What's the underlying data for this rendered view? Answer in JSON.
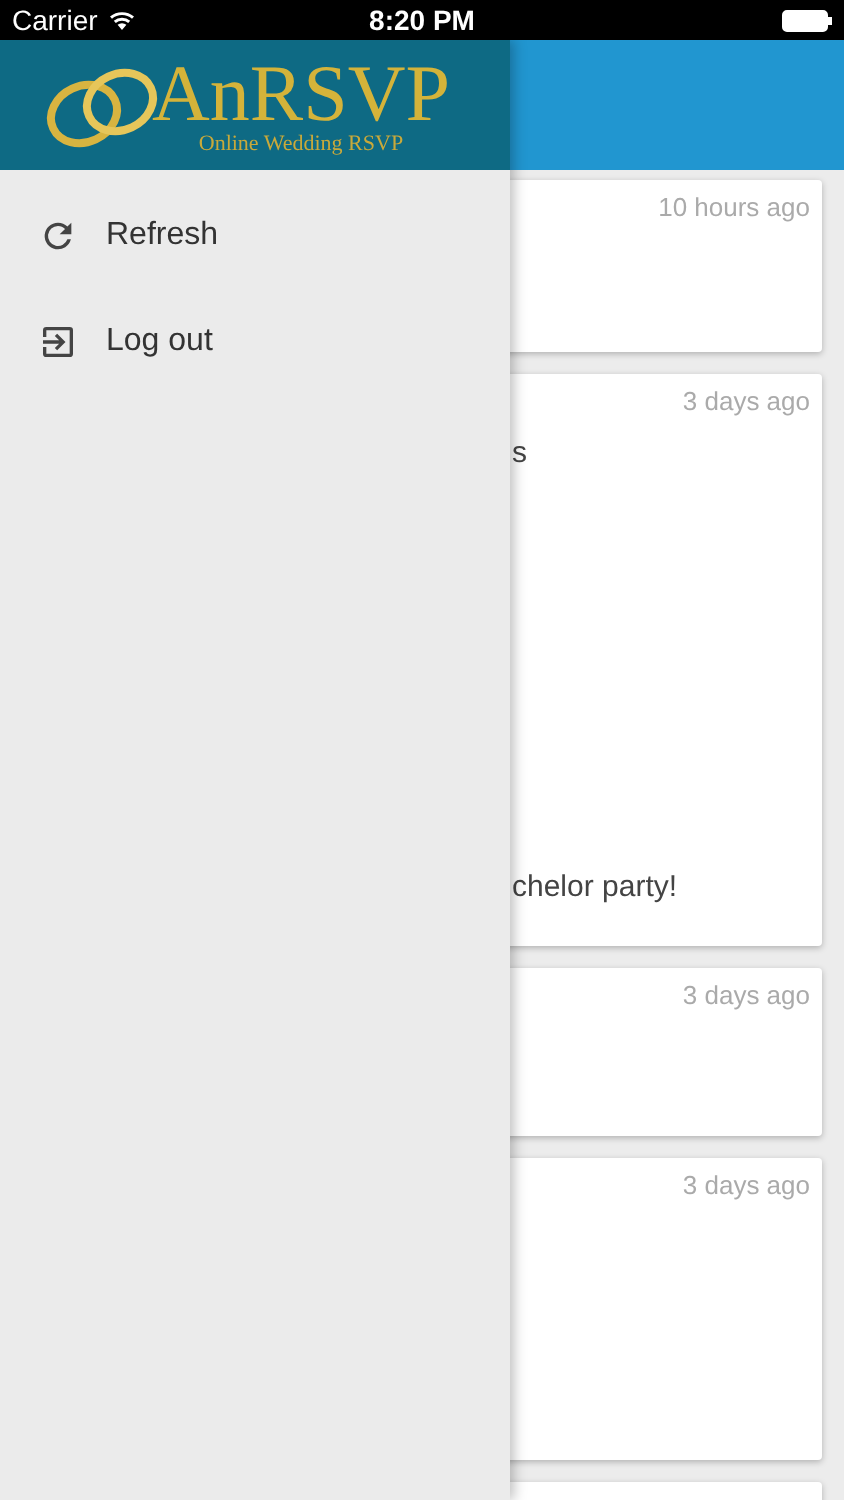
{
  "status_bar": {
    "carrier": "Carrier",
    "time": "8:20 PM"
  },
  "drawer": {
    "logo": {
      "title": "AnRSVP",
      "subtitle": "Online Wedding RSVP"
    },
    "items": [
      {
        "label": "Refresh",
        "kind": "refresh"
      },
      {
        "label": "Log out",
        "kind": "logout"
      }
    ]
  },
  "feed": [
    {
      "time": "10 hours ago"
    },
    {
      "time": "3 days ago",
      "lines": [
        "s",
        "chelor party!"
      ]
    },
    {
      "time": "3 days ago"
    },
    {
      "time": "3 days ago"
    }
  ]
}
